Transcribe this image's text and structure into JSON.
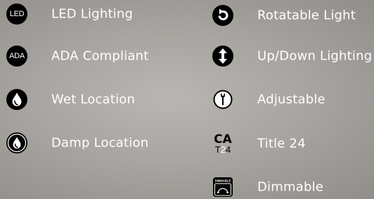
{
  "left_column": [
    {
      "icon": "led-icon",
      "icon_text": "LED",
      "label": "LED Lighting"
    },
    {
      "icon": "ada-icon",
      "icon_text": "ADA",
      "label": "ADA Compliant"
    },
    {
      "icon": "water-drop-icon",
      "label": "Wet Location"
    },
    {
      "icon": "damp-drop-icon",
      "label": "Damp Location"
    }
  ],
  "right_column": [
    {
      "icon": "rotate-icon",
      "label": "Rotatable Light"
    },
    {
      "icon": "up-down-arrow-icon",
      "label": "Up/Down Lighting"
    },
    {
      "icon": "wrench-icon",
      "label": "Adjustable"
    },
    {
      "icon": "title24-icon",
      "icon_text_top": "CA",
      "icon_text_bottom_1": "T",
      "icon_text_bottom_2": "2",
      "icon_text_bottom_3": "4",
      "label": "Title 24"
    },
    {
      "icon": "dimmable-icon",
      "icon_text": "DIMMABLE",
      "label": "Dimmable"
    }
  ]
}
